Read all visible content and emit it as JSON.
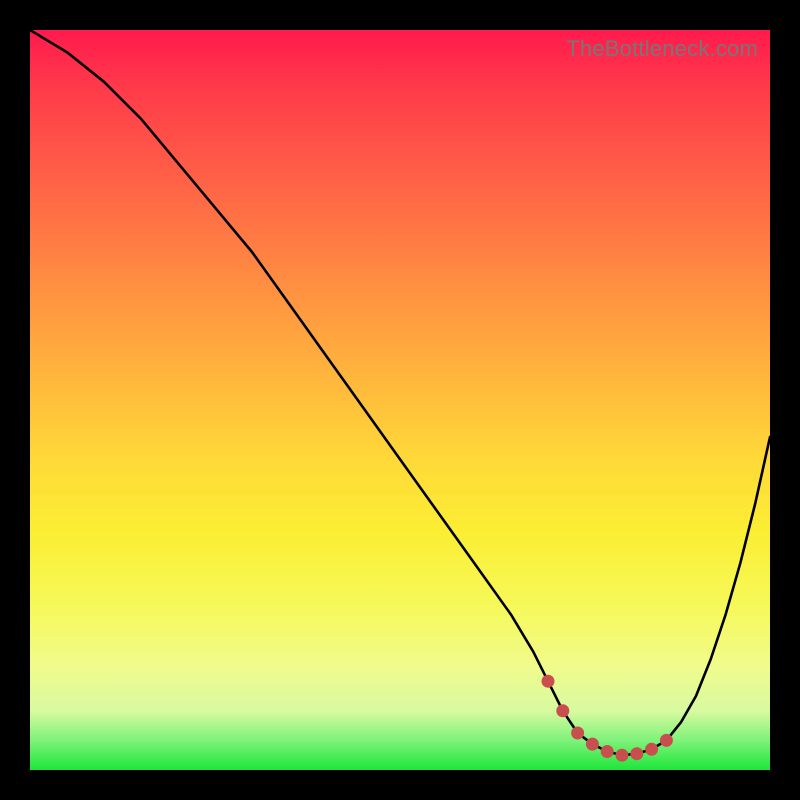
{
  "watermark": "TheBottleneck.com",
  "colors": {
    "curve": "#000000",
    "marker": "#c94f4f",
    "background_frame": "#000000"
  },
  "chart_data": {
    "type": "line",
    "title": "",
    "xlabel": "",
    "ylabel": "",
    "xlim": [
      0,
      100
    ],
    "ylim": [
      0,
      100
    ],
    "grid": false,
    "series": [
      {
        "name": "bottleneck-curve",
        "x": [
          0,
          5,
          10,
          15,
          20,
          25,
          30,
          35,
          40,
          45,
          50,
          55,
          60,
          65,
          68,
          70,
          72,
          74,
          76,
          78,
          80,
          82,
          84,
          86,
          88,
          90,
          92,
          94,
          96,
          98,
          100
        ],
        "y": [
          100,
          97,
          93,
          88,
          82,
          76,
          70,
          63,
          56,
          49,
          42,
          35,
          28,
          21,
          16,
          12,
          8,
          5,
          3.5,
          2.5,
          2,
          2.2,
          2.8,
          4,
          6.5,
          10,
          15,
          21,
          28,
          36,
          45
        ]
      }
    ],
    "markers": {
      "name": "highlight-dots",
      "x": [
        70,
        72,
        74,
        76,
        78,
        80,
        82,
        84,
        86
      ],
      "y": [
        12,
        8,
        5,
        3.5,
        2.5,
        2,
        2.2,
        2.8,
        4
      ]
    }
  }
}
